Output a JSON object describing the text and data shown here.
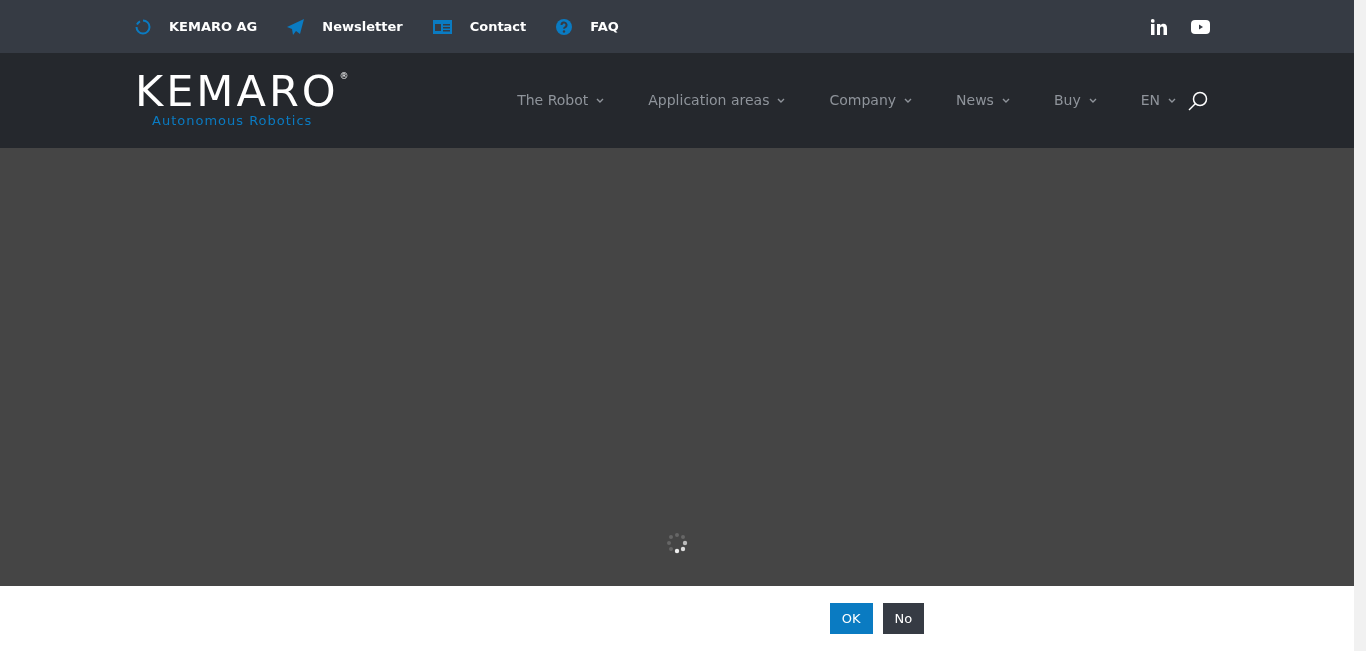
{
  "top_bar": {
    "links": [
      {
        "label": "KEMARO AG"
      },
      {
        "label": "Newsletter"
      },
      {
        "label": "Contact"
      },
      {
        "label": "FAQ"
      }
    ]
  },
  "header": {
    "logo": {
      "name": "KEMARO",
      "mark": "®",
      "tagline": "Autonomous Robotics"
    },
    "nav": [
      {
        "label": "The Robot"
      },
      {
        "label": "Application areas"
      },
      {
        "label": "Company"
      },
      {
        "label": "News"
      },
      {
        "label": "Buy"
      },
      {
        "label": "EN"
      }
    ]
  },
  "cookie_bar": {
    "buttons": [
      {
        "label": "OK",
        "kind": "accept"
      },
      {
        "label": "No",
        "kind": "decline"
      }
    ]
  }
}
